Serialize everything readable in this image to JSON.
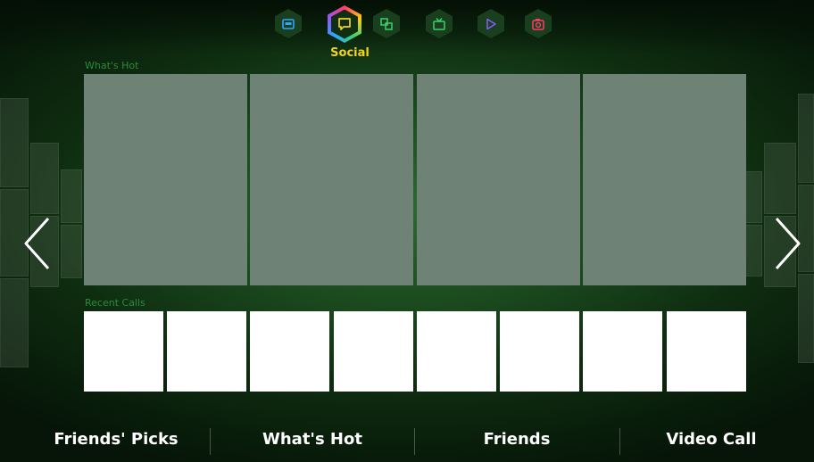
{
  "top_tabs": {
    "items": [
      {
        "icon": "on-tv-icon",
        "color": "#29a8ff"
      },
      {
        "icon": "social-icon",
        "color": "#f3d21a",
        "active": true
      },
      {
        "icon": "apps-icon",
        "color": "#3bd16f"
      },
      {
        "icon": "movies-tv-shows-icon",
        "color": "#3bd16f"
      },
      {
        "icon": "videos-icon",
        "color": "#8a5bff"
      },
      {
        "icon": "photos-icon",
        "color": "#ff3b6b"
      }
    ],
    "active_label": "Social"
  },
  "sections": {
    "whats_hot_label": "What's Hot",
    "recent_calls_label": "Recent Calls"
  },
  "bottom_menu": {
    "items": [
      "Friends' Picks",
      "What's Hot",
      "Friends",
      "Video Call"
    ]
  },
  "colors": {
    "accent": "#f3d21a",
    "section_label": "#2c8a3b",
    "hot_tile": "#6e8275",
    "call_tile": "#ffffff"
  }
}
